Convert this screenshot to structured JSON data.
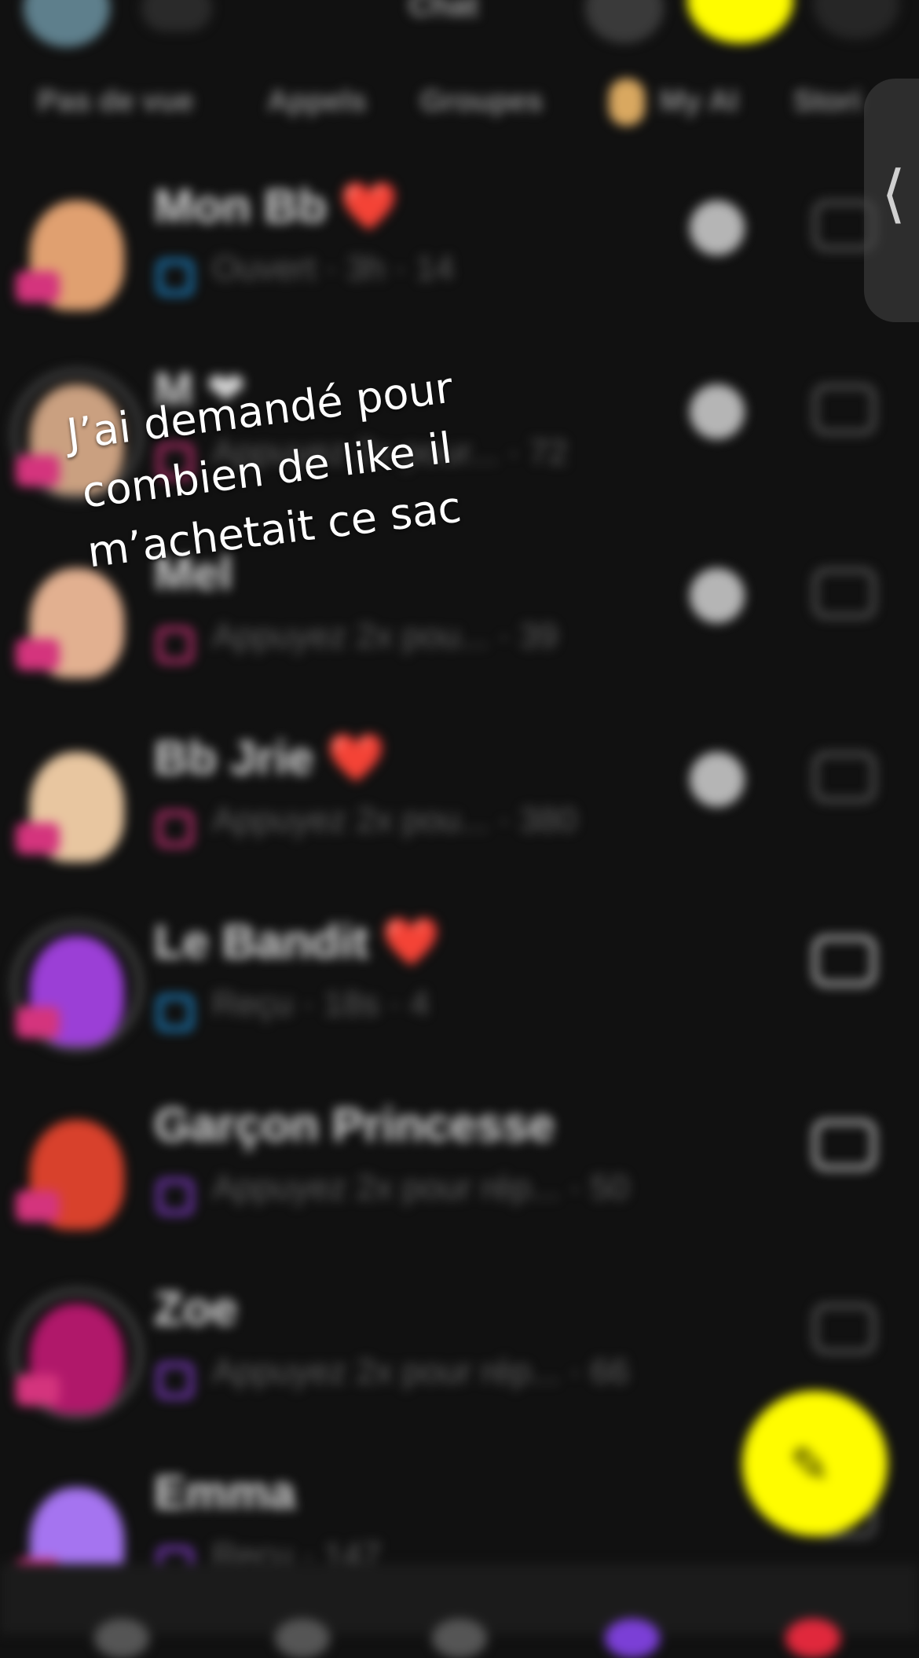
{
  "caption": {
    "line1": "J’ai demandé pour",
    "line2": "combien de like il",
    "line3": "m’achetait ce sac"
  },
  "header": {
    "title": "Chat"
  },
  "tabs": [
    "Pas de vue",
    "Appels",
    "Groupes",
    "My AI",
    "Stori"
  ],
  "chats": [
    {
      "name": "Mon Bb ❤️",
      "status": "Ouvert · 3h · 14",
      "avatar_color": "#e0a070",
      "status_color": "#1e8fd8",
      "camera_bright": false,
      "has_reply": true,
      "ring": false
    },
    {
      "name": "M ❤",
      "status": "Appuyez 2x pour... · 72",
      "avatar_color": "#caa080",
      "status_color": "#d4347d",
      "camera_bright": false,
      "has_reply": true,
      "ring": true
    },
    {
      "name": "Mel",
      "status": "Appuyez 2x pou... · 39",
      "avatar_color": "#e2b090",
      "status_color": "#d4347d",
      "camera_bright": false,
      "has_reply": true,
      "ring": false
    },
    {
      "name": "Bb Jrie ❤️",
      "status": "Appuyez 2x pou... · 380",
      "avatar_color": "#e8c6a0",
      "status_color": "#d4347d",
      "camera_bright": false,
      "has_reply": true,
      "ring": false
    },
    {
      "name": "Le Bandit ❤️",
      "status": "Reçu · 18s · 4",
      "avatar_color": "#9b3fd6",
      "status_color": "#1e8fd8",
      "camera_bright": true,
      "has_reply": false,
      "ring": true
    },
    {
      "name": "Garçon Princesse",
      "status": "Appuyez 2x pour rép... · 50",
      "avatar_color": "#d8412c",
      "status_color": "#8a3fd6",
      "camera_bright": true,
      "has_reply": false,
      "ring": false
    },
    {
      "name": "Zoe",
      "status": "Appuyez 2x pour rép... · 66",
      "avatar_color": "#b0186a",
      "status_color": "#8a3fd6",
      "camera_bright": false,
      "has_reply": false,
      "ring": true
    },
    {
      "name": "Emma",
      "status": "Reçu · 147",
      "avatar_color": "#a574f0",
      "status_color": "#8a3fd6",
      "camera_bright": false,
      "has_reply": false,
      "ring": false
    }
  ],
  "icons": {
    "edge_handle": "chevron-left-icon",
    "fab": "new-chat-icon",
    "reply": "reply-icon",
    "camera": "camera-icon"
  },
  "colors": {
    "accent": "#fffc00",
    "background": "#111111"
  }
}
